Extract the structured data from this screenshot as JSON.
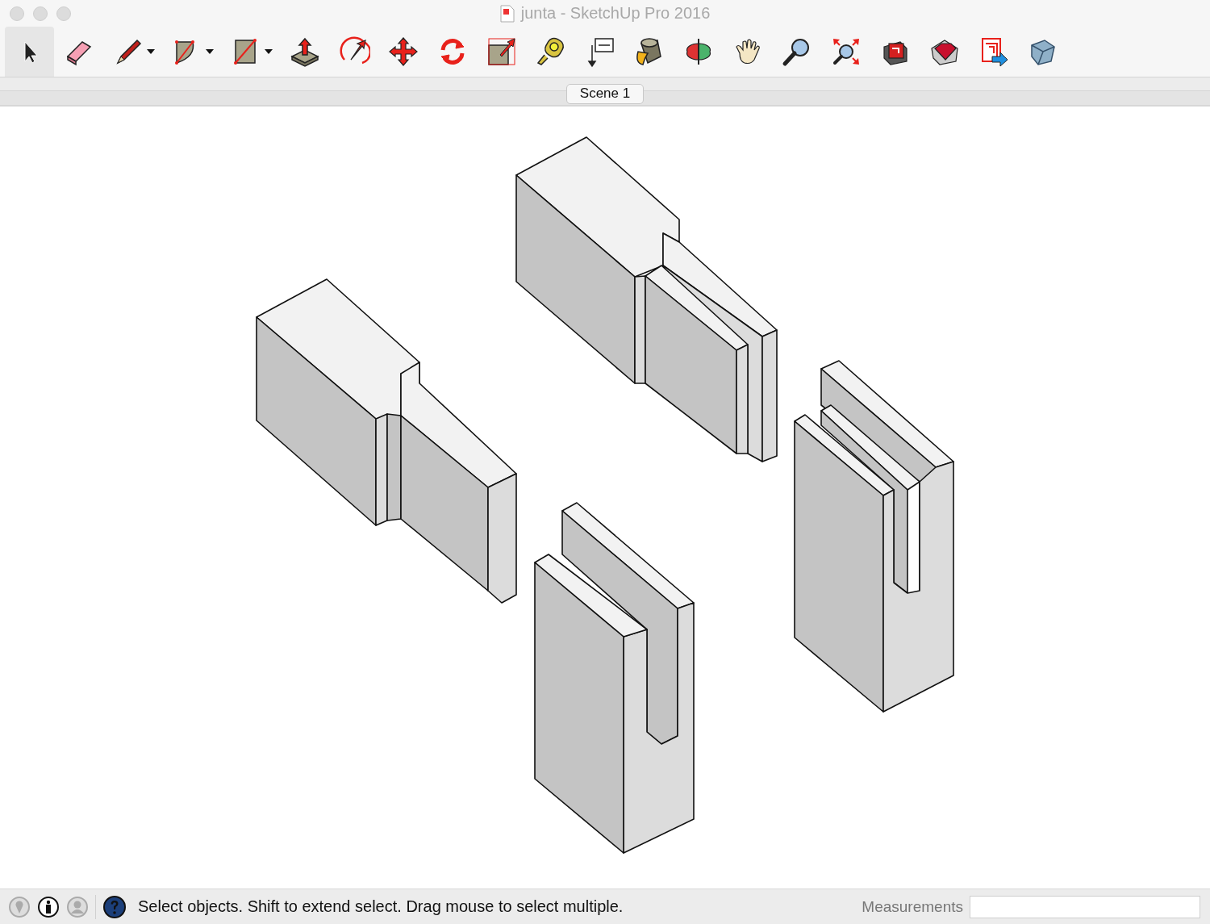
{
  "window": {
    "title": "junta - SketchUp Pro 2016"
  },
  "toolbar": {
    "tools": [
      {
        "kind": "select",
        "selected": true,
        "dropdown": false
      },
      {
        "kind": "eraser",
        "selected": false,
        "dropdown": false
      },
      {
        "kind": "pencil",
        "selected": false,
        "dropdown": true
      },
      {
        "kind": "arc",
        "selected": false,
        "dropdown": true
      },
      {
        "kind": "rectangle",
        "selected": false,
        "dropdown": true
      },
      {
        "kind": "pushpull",
        "selected": false,
        "dropdown": false
      },
      {
        "kind": "followme",
        "selected": false,
        "dropdown": false
      },
      {
        "kind": "move",
        "selected": false,
        "dropdown": false
      },
      {
        "kind": "rotate",
        "selected": false,
        "dropdown": false
      },
      {
        "kind": "scale",
        "selected": false,
        "dropdown": false
      },
      {
        "kind": "tape",
        "selected": false,
        "dropdown": false
      },
      {
        "kind": "text",
        "selected": false,
        "dropdown": false
      },
      {
        "kind": "paint",
        "selected": false,
        "dropdown": false
      },
      {
        "kind": "orbit",
        "selected": false,
        "dropdown": false
      },
      {
        "kind": "pan",
        "selected": false,
        "dropdown": false
      },
      {
        "kind": "zoom",
        "selected": false,
        "dropdown": false
      },
      {
        "kind": "extents",
        "selected": false,
        "dropdown": false
      },
      {
        "kind": "warehouse",
        "selected": false,
        "dropdown": false
      },
      {
        "kind": "gem",
        "selected": false,
        "dropdown": false
      },
      {
        "kind": "layout",
        "selected": false,
        "dropdown": false
      },
      {
        "kind": "box",
        "selected": false,
        "dropdown": false
      }
    ]
  },
  "scenes": [
    {
      "label": "Scene 1",
      "selected": true
    }
  ],
  "status_bar": {
    "message": "Select objects. Shift to extend select. Drag mouse to select multiple.",
    "measurements_label": "Measurements"
  }
}
